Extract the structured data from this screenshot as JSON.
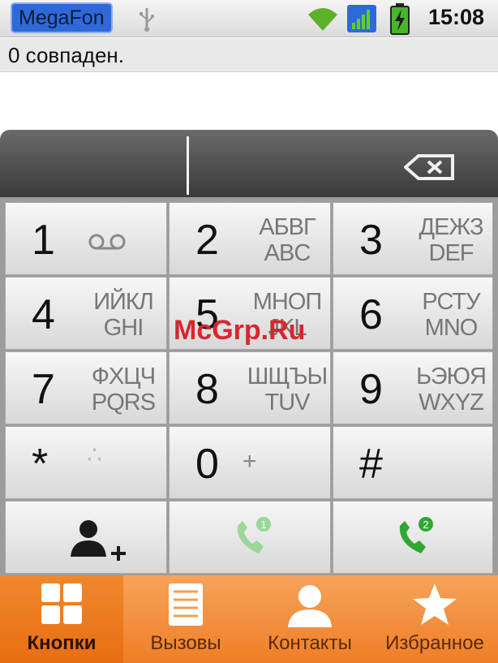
{
  "statusbar": {
    "carrier": "MegaFon",
    "time": "15:08",
    "icons": [
      "usb-icon",
      "wifi-icon",
      "signal-icon",
      "battery-charging-icon"
    ],
    "colors": {
      "carrier_bg": "#2f69d8",
      "wifi": "#5fb02a",
      "battery": "#49b52c"
    }
  },
  "search": {
    "match_text": "0 совпаден."
  },
  "keypad": {
    "keys": [
      {
        "digit": "1",
        "letters_ru": "",
        "letters_en": "",
        "icon": "voicemail-icon"
      },
      {
        "digit": "2",
        "letters_ru": "АБВГ",
        "letters_en": "ABC"
      },
      {
        "digit": "3",
        "letters_ru": "ДЕЖЗ",
        "letters_en": "DEF"
      },
      {
        "digit": "4",
        "letters_ru": "ИЙКЛ",
        "letters_en": "GHI"
      },
      {
        "digit": "5",
        "letters_ru": "МНОП",
        "letters_en": "JKL"
      },
      {
        "digit": "6",
        "letters_ru": "РСТУ",
        "letters_en": "MNO"
      },
      {
        "digit": "7",
        "letters_ru": "ФХЦЧ",
        "letters_en": "PQRS"
      },
      {
        "digit": "8",
        "letters_ru": "ШЩЪЫ",
        "letters_en": "TUV"
      },
      {
        "digit": "9",
        "letters_ru": "ЬЭЮЯ",
        "letters_en": "WXYZ"
      },
      {
        "digit": "*",
        "sub": "∴"
      },
      {
        "digit": "0",
        "sub": "+"
      },
      {
        "digit": "#",
        "sub": ""
      }
    ],
    "actions": [
      "add-contact-icon",
      "call-sim1-icon",
      "call-sim2-icon"
    ],
    "call_sim2_badge": "2",
    "call_sim1_badge": "1"
  },
  "tabs": [
    {
      "label": "Кнопки",
      "icon": "dialpad-icon",
      "active": true
    },
    {
      "label": "Вызовы",
      "icon": "call-log-icon",
      "active": false
    },
    {
      "label": "Контакты",
      "icon": "contacts-icon",
      "active": false
    },
    {
      "label": "Избранное",
      "icon": "star-icon",
      "active": false
    }
  ],
  "watermark": "McGrp.Ru"
}
